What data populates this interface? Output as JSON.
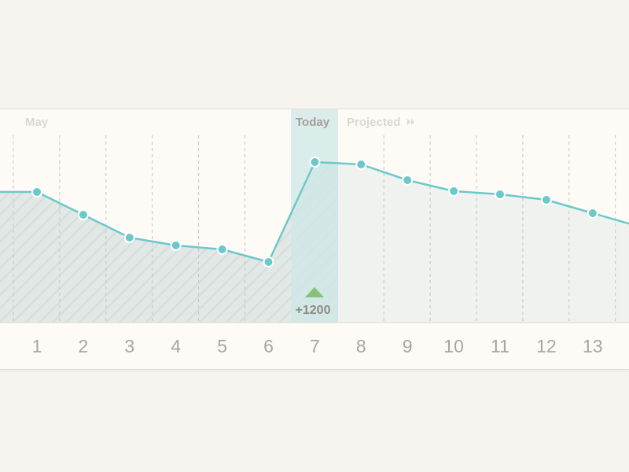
{
  "chart_data": {
    "type": "line",
    "period_label": "May",
    "today_label": "Today",
    "projected_label": "Projected",
    "x": [
      "1",
      "2",
      "3",
      "4",
      "5",
      "6",
      "7",
      "8",
      "9",
      "10",
      "11",
      "12",
      "13"
    ],
    "values": [
      244,
      273,
      302,
      312,
      317,
      333,
      206,
      209,
      229,
      243,
      247,
      254,
      271
    ],
    "today_index": 6,
    "today_delta": "+1200",
    "colors": {
      "line": "#6cc9c9",
      "past_fill": "#e1e8e6",
      "projected_fill": "#f0f2f0",
      "today_band": "#cde8e5",
      "delta_arrow": "#86c07a",
      "header_muted": "#dcd7d2",
      "header_today": "#a39e99"
    }
  }
}
